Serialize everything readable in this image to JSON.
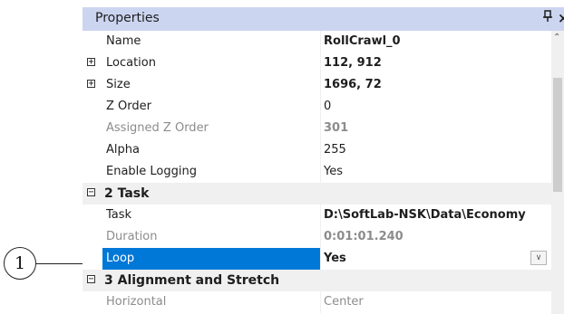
{
  "callout": {
    "number": "1"
  },
  "panel": {
    "title": "Properties",
    "pin_glyph": "\u0004",
    "close_glyph": "×"
  },
  "rows": [
    {
      "kind": "prop",
      "name": "Name",
      "value": "RollCrawl_0",
      "bold": true
    },
    {
      "kind": "prop",
      "name": "Location",
      "value": "112, 912",
      "bold": true,
      "expander": "+"
    },
    {
      "kind": "prop",
      "name": "Size",
      "value": "1696, 72",
      "bold": true,
      "expander": "+"
    },
    {
      "kind": "prop",
      "name": "Z Order",
      "value": "0"
    },
    {
      "kind": "prop",
      "name": "Assigned Z Order",
      "value": "301",
      "readonly": true,
      "bold": true
    },
    {
      "kind": "prop",
      "name": "Alpha",
      "value": "255"
    },
    {
      "kind": "prop",
      "name": "Enable Logging",
      "value": "Yes"
    },
    {
      "kind": "category",
      "name": "2 Task",
      "expander": "−"
    },
    {
      "kind": "prop",
      "name": "Task",
      "value": "D:\\SoftLab-NSK\\Data\\Economy",
      "bold": true
    },
    {
      "kind": "prop",
      "name": "Duration",
      "value": "0:01:01.240",
      "readonly": true,
      "bold": true
    },
    {
      "kind": "prop",
      "name": "Loop",
      "value": "Yes",
      "bold": true,
      "selected": true,
      "dropdown": true
    },
    {
      "kind": "category",
      "name": "3 Alignment and Stretch",
      "expander": "−"
    },
    {
      "kind": "prop",
      "name": "Horizontal",
      "value": "Center",
      "readonly": true,
      "nameReadonly": true
    }
  ],
  "colors": {
    "titlebar": "#ccd5f0",
    "selection": "#0078d7",
    "category_bg": "#f0f0f0",
    "readonly_text": "#8c8c8c"
  }
}
